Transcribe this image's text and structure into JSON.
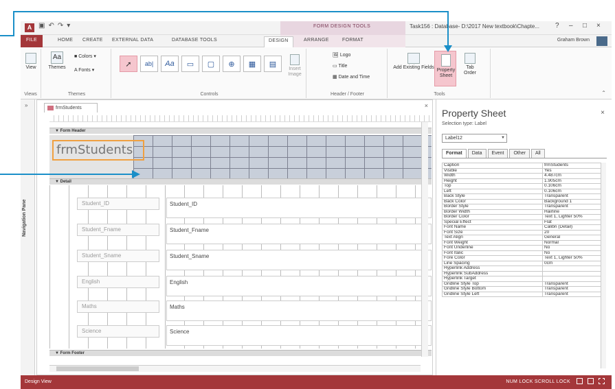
{
  "window": {
    "title": "Task156 : Database- D:\\2017 New textbook\\Chapte...",
    "context_group": "FORM DESIGN TOOLS",
    "controls": [
      "?",
      "–",
      "□",
      "×"
    ]
  },
  "ribbon_tabs": {
    "file": "FILE",
    "items": [
      "HOME",
      "CREATE",
      "EXTERNAL DATA",
      "DATABASE TOOLS"
    ],
    "context_items": [
      "DESIGN",
      "ARRANGE",
      "FORMAT"
    ],
    "active": "DESIGN",
    "user": "Graham Brown"
  },
  "ribbon": {
    "views": {
      "label": "Views",
      "view_button": "View"
    },
    "themes": {
      "label": "Themes",
      "themes_button": "Themes",
      "colors": "Colors",
      "fonts": "Fonts"
    },
    "controls": {
      "label": "Controls",
      "insert_image": "Insert Image"
    },
    "header_footer": {
      "label": "Header / Footer",
      "logo": "Logo",
      "title": "Title",
      "date_time": "Date and Time"
    },
    "tools": {
      "label": "Tools",
      "add_existing_fields": "Add Existing Fields",
      "property_sheet": "Property Sheet",
      "tab_order": "Tab Order"
    }
  },
  "nav_pane": {
    "label": "Navigation Pane"
  },
  "document": {
    "tab": "frmStudents",
    "sections": {
      "header": "Form Header",
      "detail": "Detail",
      "footer": "Form Footer"
    },
    "header_label": "frmStudents",
    "fields": [
      {
        "label": "Student_ID",
        "textbox": "Student_ID"
      },
      {
        "label": "Student_Fname",
        "textbox": "Student_Fname"
      },
      {
        "label": "Student_Sname",
        "textbox": "Student_Sname"
      },
      {
        "label": "English",
        "textbox": "English"
      },
      {
        "label": "Maths",
        "textbox": "Maths"
      },
      {
        "label": "Science",
        "textbox": "Science"
      }
    ]
  },
  "property_sheet": {
    "title": "Property Sheet",
    "selection_type": "Selection type: Label",
    "selected": "Label12",
    "tabs": [
      "Format",
      "Data",
      "Event",
      "Other",
      "All"
    ],
    "active_tab": "Format",
    "rows": [
      [
        "Caption",
        "frmStudents"
      ],
      [
        "Visible",
        "Yes"
      ],
      [
        "Width",
        "4.487cm"
      ],
      [
        "Height",
        "1.905cm"
      ],
      [
        "Top",
        "0.106cm"
      ],
      [
        "Left",
        "0.106cm"
      ],
      [
        "Back Style",
        "Transparent"
      ],
      [
        "Back Color",
        "Background 1"
      ],
      [
        "Border Style",
        "Transparent"
      ],
      [
        "Border Width",
        "Hairline"
      ],
      [
        "Border Color",
        "Text 1, Lighter 50%"
      ],
      [
        "Special Effect",
        "Flat"
      ],
      [
        "Font Name",
        "Calibri (Detail)"
      ],
      [
        "Font Size",
        "20"
      ],
      [
        "Text Align",
        "General"
      ],
      [
        "Font Weight",
        "Normal"
      ],
      [
        "Font Underline",
        "No"
      ],
      [
        "Font Italic",
        "No"
      ],
      [
        "Fore Color",
        "Text 1, Lighter 50%"
      ],
      [
        "Line Spacing",
        "0cm"
      ],
      [
        "Hyperlink Address",
        ""
      ],
      [
        "Hyperlink SubAddress",
        ""
      ],
      [
        "Hyperlink Target",
        ""
      ],
      [
        "Gridline Style Top",
        "Transparent"
      ],
      [
        "Gridline Style Bottom",
        "Transparent"
      ],
      [
        "Gridline Style Left",
        "Transparent"
      ]
    ]
  },
  "status": {
    "left": "Design View",
    "right": "NUM LOCK   SCROLL LOCK"
  },
  "colors": {
    "accent": "#a4373a",
    "arrow": "#1a8fc8",
    "selection": "#f0a040",
    "property_highlight": "#f5c6ce"
  }
}
